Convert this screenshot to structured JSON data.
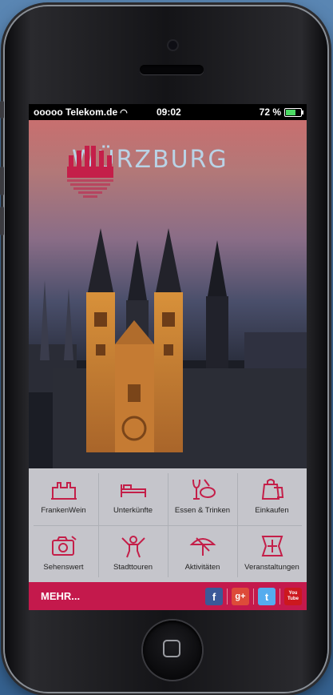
{
  "status_bar": {
    "carrier": "ooooo Telekom.de",
    "time": "09:02",
    "battery": "72 %",
    "battery_level": 0.72
  },
  "hero": {
    "logo_text": "WÜRZBURG"
  },
  "menu": {
    "items": [
      {
        "label": "FrankenWein",
        "icon": "wine-castle-icon"
      },
      {
        "label": "Unterkünfte",
        "icon": "bed-icon"
      },
      {
        "label": "Essen & Trinken",
        "icon": "food-drink-icon"
      },
      {
        "label": "Einkaufen",
        "icon": "shopping-bag-icon"
      },
      {
        "label": "Sehenswert",
        "icon": "camera-icon"
      },
      {
        "label": "Stadttouren",
        "icon": "guide-person-icon"
      },
      {
        "label": "Aktivitäten",
        "icon": "umbrella-icon"
      },
      {
        "label": "Veranstaltungen",
        "icon": "spotlight-icon"
      }
    ]
  },
  "bottom_bar": {
    "more_label": "MEHR...",
    "social": [
      {
        "name": "facebook-icon",
        "glyph": "f",
        "color": "#3b5998"
      },
      {
        "name": "google-plus-icon",
        "glyph": "g+",
        "color": "#dd4b39"
      },
      {
        "name": "twitter-icon",
        "glyph": "t",
        "color": "#55acee"
      },
      {
        "name": "youtube-icon",
        "glyph": "You Tube",
        "color": "#cc181e"
      }
    ]
  },
  "colors": {
    "accent": "#c4194c",
    "logo_text": "#b9d3e6"
  }
}
